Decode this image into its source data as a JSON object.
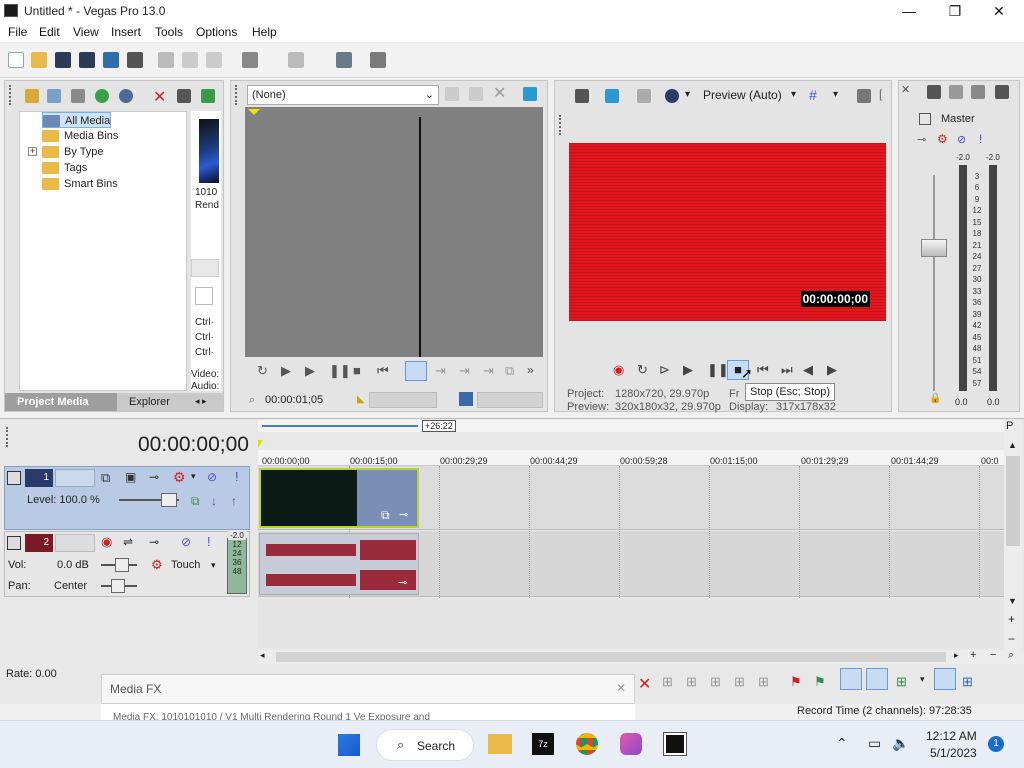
{
  "window": {
    "title": "Untitled * - Vegas Pro 13.0",
    "minimize": "—",
    "maximize": "❐",
    "close": "✕"
  },
  "menu": [
    "File",
    "Edit",
    "View",
    "Insert",
    "Tools",
    "Options",
    "Help"
  ],
  "media_tree": {
    "items": [
      "All Media",
      "Media Bins",
      "By Type",
      "Tags",
      "Smart Bins"
    ],
    "expander": "+"
  },
  "media_thumb": {
    "caption1": "1010",
    "caption2": "Rend",
    "ctrl1": "Ctrl·",
    "ctrl2": "Ctrl·",
    "ctrl3": "Ctrl·",
    "video": "Video:",
    "audio": "Audio:"
  },
  "media_tabs": {
    "project_media": "Project Media",
    "explorer": "Explorer"
  },
  "trimmer": {
    "dropdown": "(None)",
    "timecode": "00:00:01;05"
  },
  "preview": {
    "quality": "Preview (Auto)",
    "overlay_timecode": "00:00:00;00",
    "project_label": "Project:",
    "project_value": "1280x720, 29.970p",
    "preview_label": "Preview:",
    "preview_value": "320x180x32, 29.970p",
    "frame_label": "Fr",
    "display_label": "Display:",
    "display_value": "317x178x32",
    "tooltip": "Stop (Esc; Stop)",
    "video_color": "#e4151c"
  },
  "master": {
    "title": "Master",
    "left_peak": "-2.0",
    "right_peak": "-2.0",
    "ticks": [
      "3",
      "6",
      "9",
      "12",
      "15",
      "18",
      "21",
      "24",
      "27",
      "30",
      "33",
      "36",
      "39",
      "42",
      "45",
      "48",
      "51",
      "54",
      "57"
    ],
    "left_level": "0.0",
    "right_level": "0.0"
  },
  "timeline": {
    "cursor_time": "00:00:00;00",
    "loop_length": "+26:22",
    "ruler": [
      "00:00:00;00",
      "00:00:15;00",
      "00:00:29;29",
      "00:00:44;29",
      "00:00:59;28",
      "00:01:15;00",
      "00:01:29;29",
      "00:01:44;29",
      "00:0"
    ],
    "video_track": {
      "number": "1",
      "level": "Level: 100.0 %"
    },
    "audio_track": {
      "number": "2",
      "vol_label": "Vol:",
      "vol_value": "0.0 dB",
      "pan_label": "Pan:",
      "pan_value": "Center",
      "automation": "Touch",
      "meter_peak": "-2.0",
      "meter_ticks": [
        "12",
        "24",
        "36",
        "48"
      ]
    },
    "rate": "Rate: 0.00"
  },
  "media_fx_dialog": {
    "title": "Media FX",
    "close": "✕",
    "behind_text": "Media FX: 1010101010 / V1 Multi Rendering Round 1 Ve Exposure and"
  },
  "status": {
    "record_time": "Record Time (2 channels): 97:28:35"
  },
  "taskbar": {
    "search": "Search",
    "time": "12:12 AM",
    "date": "5/1/2023",
    "notifications": "1"
  }
}
